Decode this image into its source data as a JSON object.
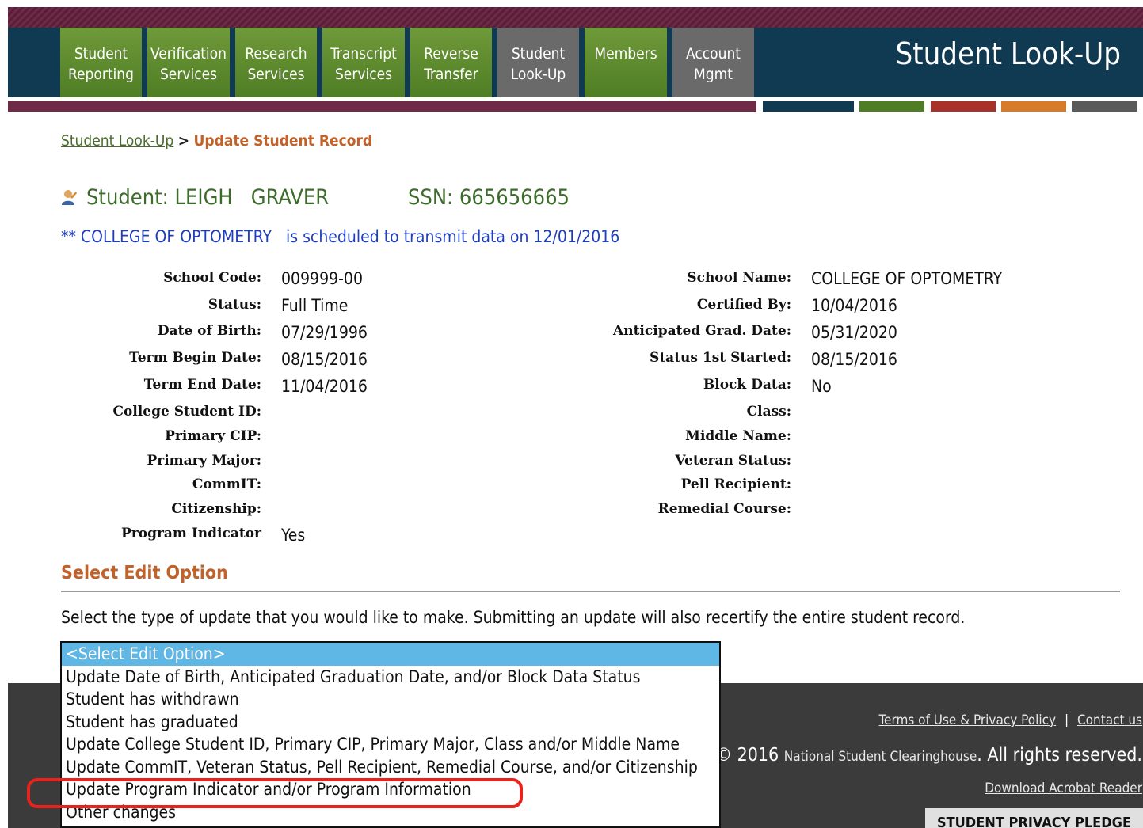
{
  "header": {
    "title": "Student Look-Up",
    "nav": [
      {
        "label": "Student\nReporting",
        "active": false
      },
      {
        "label": "Verification\nServices",
        "active": false
      },
      {
        "label": "Research\nServices",
        "active": false
      },
      {
        "label": "Transcript\nServices",
        "active": false
      },
      {
        "label": "Reverse\nTransfer",
        "active": false
      },
      {
        "label": "Student\nLook-Up",
        "active": true
      },
      {
        "label": "Members",
        "active": false
      },
      {
        "label": "Account\nMgmt",
        "active": true
      }
    ]
  },
  "breadcrumb": {
    "parent": "Student Look-Up",
    "separator": ">",
    "current": "Update Student Record"
  },
  "student": {
    "name_line": "Student: LEIGH   GRAVER",
    "ssn_line": "SSN: 665656665"
  },
  "notice": "** COLLEGE OF OPTOMETRY   is scheduled to transmit data on 12/01/2016",
  "details_left": [
    {
      "label": "School Code:",
      "value": "009999-00"
    },
    {
      "label": "Status:",
      "value": "Full Time"
    },
    {
      "label": "Date of Birth:",
      "value": "07/29/1996"
    },
    {
      "label": "Term Begin Date:",
      "value": "08/15/2016"
    },
    {
      "label": "Term End Date:",
      "value": "11/04/2016"
    },
    {
      "label": "College Student ID:",
      "value": ""
    },
    {
      "label": "Primary CIP:",
      "value": ""
    },
    {
      "label": "Primary Major:",
      "value": ""
    },
    {
      "label": "CommIT:",
      "value": ""
    },
    {
      "label": "Citizenship:",
      "value": ""
    },
    {
      "label": "Program Indicator",
      "value": "Yes"
    }
  ],
  "details_right": [
    {
      "label": "School Name:",
      "value": "COLLEGE OF OPTOMETRY"
    },
    {
      "label": "Certified By:",
      "value": "10/04/2016"
    },
    {
      "label": "Anticipated Grad. Date:",
      "value": "05/31/2020"
    },
    {
      "label": "Status 1st Started:",
      "value": "08/15/2016"
    },
    {
      "label": "Block Data:",
      "value": "No"
    },
    {
      "label": "Class:",
      "value": ""
    },
    {
      "label": "Middle Name:",
      "value": ""
    },
    {
      "label": "Veteran Status:",
      "value": ""
    },
    {
      "label": "Pell Recipient:",
      "value": ""
    },
    {
      "label": "Remedial Course:",
      "value": ""
    }
  ],
  "edit": {
    "heading": "Select Edit Option",
    "instructions": "Select the type of update that you would like to make. Submitting an update will also recertify the entire student record.",
    "options": [
      "<Select Edit Option>",
      "Update Date of Birth, Anticipated Graduation Date, and/or Block Data Status",
      "Student has withdrawn",
      "Student has graduated",
      "Update College Student ID, Primary CIP, Primary Major, Class and/or Middle Name",
      "Update CommIT, Veteran Status, Pell Recipient, Remedial Course, and/or Citizenship",
      "Update Program Indicator and/or Program Information",
      "Other changes"
    ],
    "selected_index": 0,
    "highlighted_index": 6
  },
  "footer": {
    "terms": "Terms of Use & Privacy Policy",
    "divider": "|",
    "contact": "Contact us",
    "copyright_prefix": "© 2016",
    "org": "National Student Clearinghouse",
    "copyright_suffix": ". All rights reserved.",
    "acrobat": "Download Acrobat Reader",
    "pledge": "STUDENT PRIVACY PLEDGE"
  },
  "colors": {
    "accent_green": "#4f7d24",
    "header_navy": "#0f3a52",
    "maroon": "#6e2a47",
    "orange": "#c0622a",
    "selection_blue": "#5fb7e6",
    "annotation_red": "#e8221c"
  }
}
